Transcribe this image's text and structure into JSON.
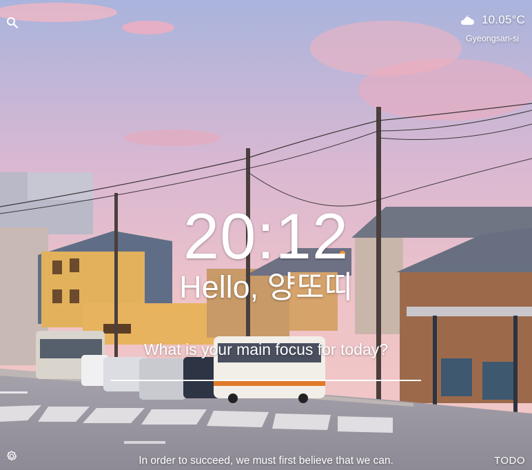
{
  "weather": {
    "temperature": "10.05°C",
    "location": "Gyeongsan-si",
    "icon": "partly-cloudy-night-icon"
  },
  "clock": {
    "time": "20:12"
  },
  "greeting": {
    "text": "Hello, 양또띠"
  },
  "focus": {
    "question": "What is your main focus for today?",
    "value": ""
  },
  "quote": {
    "text": "In order to succeed, we must first believe that we can."
  },
  "bottom": {
    "todo_label": "TODO"
  },
  "icons": {
    "search": "search-icon",
    "settings": "gear-icon"
  }
}
